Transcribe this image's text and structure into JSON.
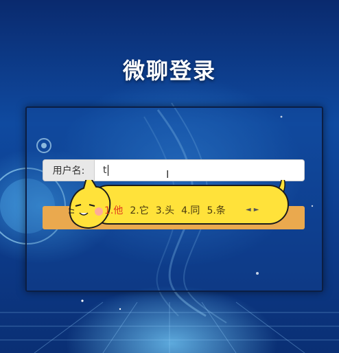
{
  "page": {
    "title": "微聊登录"
  },
  "form": {
    "username_label": "用户名:",
    "username_value": "t"
  },
  "ime": {
    "candidates": [
      "1.他",
      "2.它",
      "3.头",
      "4.同",
      "5.条"
    ],
    "selected_index": 0,
    "prev_icon": "◄",
    "next_icon": "►"
  },
  "colors": {
    "login_button": "#eaa94e",
    "ime_background": "#ffe23a",
    "ime_selected": "#e0371d",
    "background": "#0f4aa0"
  }
}
